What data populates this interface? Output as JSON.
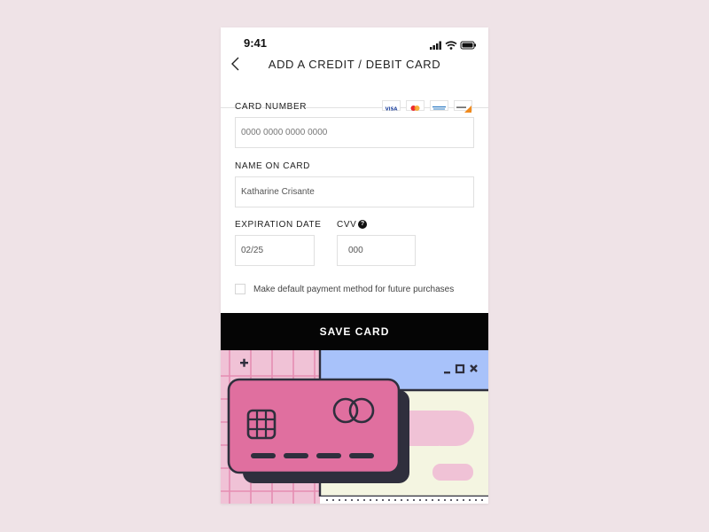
{
  "status_bar": {
    "time": "9:41"
  },
  "header": {
    "title": "ADD A CREDIT / DEBIT CARD"
  },
  "form": {
    "card_number": {
      "label": "CARD NUMBER",
      "placeholder": "0000 0000 0000 0000"
    },
    "name": {
      "label": "NAME ON CARD",
      "value": "Katharine Crisante"
    },
    "expiration": {
      "label": "EXPIRATION DATE",
      "value": "02/25"
    },
    "cvv": {
      "label": "CVV",
      "help": "?",
      "value": "000"
    },
    "default_checkbox": {
      "label": "Make default payment method for future purchases",
      "checked": false
    }
  },
  "card_logos": [
    "visa-logo",
    "mastercard-logo",
    "amex-logo",
    "discover-logo"
  ],
  "save_button": {
    "label": "SAVE CARD"
  },
  "colors": {
    "background": "#efe3e7",
    "button": "#050505",
    "card_pink": "#e06f9f",
    "card_dark": "#2f2f3d",
    "window_blue": "#a8c2fa",
    "window_cream": "#f4f5e1",
    "grid_pink": "#f0c2d6"
  }
}
